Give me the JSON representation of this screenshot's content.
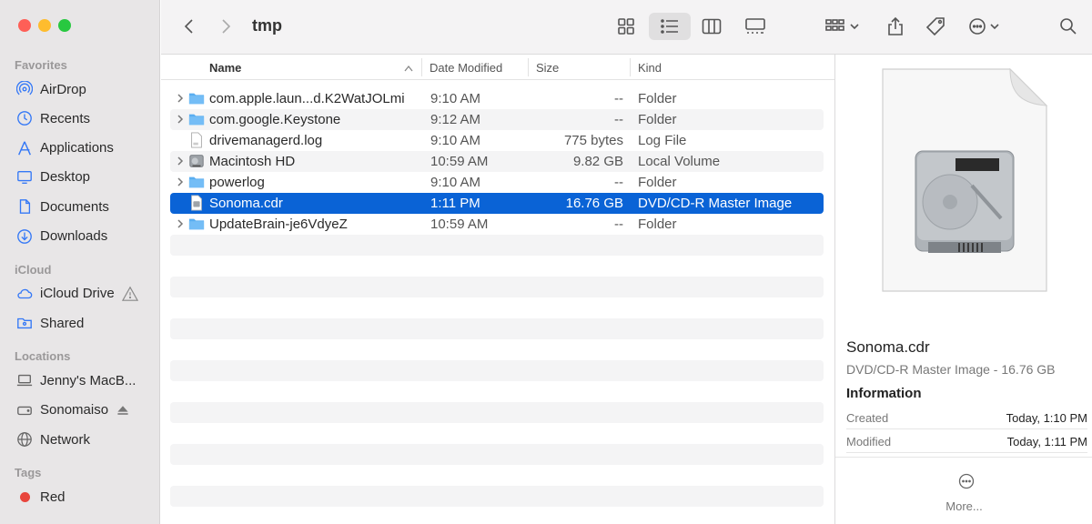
{
  "window": {
    "traffic_colors": [
      "#fe5f57",
      "#febc2e",
      "#28c840"
    ]
  },
  "sidebar": {
    "sections": [
      {
        "title": "Favorites",
        "items": [
          {
            "label": "AirDrop",
            "icon": "airdrop-icon"
          },
          {
            "label": "Recents",
            "icon": "clock-icon"
          },
          {
            "label": "Applications",
            "icon": "applications-icon"
          },
          {
            "label": "Desktop",
            "icon": "desktop-icon"
          },
          {
            "label": "Documents",
            "icon": "document-icon"
          },
          {
            "label": "Downloads",
            "icon": "download-icon"
          }
        ]
      },
      {
        "title": "iCloud",
        "items": [
          {
            "label": "iCloud Drive",
            "icon": "cloud-icon",
            "trail": "warning-icon"
          },
          {
            "label": "Shared",
            "icon": "shared-folder-icon"
          }
        ]
      },
      {
        "title": "Locations",
        "items": [
          {
            "label": "Jenny's MacB...",
            "icon": "laptop-icon"
          },
          {
            "label": "Sonomaiso",
            "icon": "disk-icon",
            "trail": "eject-icon"
          },
          {
            "label": "Network",
            "icon": "network-icon"
          }
        ]
      },
      {
        "title": "Tags",
        "items": [
          {
            "label": "Red",
            "icon": "red-tag-dot",
            "color": "#e8453c"
          }
        ]
      }
    ]
  },
  "toolbar": {
    "title": "tmp",
    "active_view": "list"
  },
  "list": {
    "columns": [
      "Name",
      "Date Modified",
      "Size",
      "Kind"
    ],
    "sort_column": "Name",
    "rows": [
      {
        "name": "com.apple.laun...d.K2WatJOLmi",
        "date": "9:10 AM",
        "size": "--",
        "kind": "Folder",
        "type": "folder",
        "expandable": true
      },
      {
        "name": "com.google.Keystone",
        "date": "9:12 AM",
        "size": "--",
        "kind": "Folder",
        "type": "folder",
        "expandable": true
      },
      {
        "name": "drivemanagerd.log",
        "date": "9:10 AM",
        "size": "775 bytes",
        "kind": "Log File",
        "type": "log",
        "expandable": false
      },
      {
        "name": "Macintosh HD",
        "date": "10:59 AM",
        "size": "9.82 GB",
        "kind": "Local Volume",
        "type": "volume",
        "expandable": true
      },
      {
        "name": "powerlog",
        "date": "9:10 AM",
        "size": "--",
        "kind": "Folder",
        "type": "folder",
        "expandable": true
      },
      {
        "name": "Sonoma.cdr",
        "date": "1:11 PM",
        "size": "16.76 GB",
        "kind": "DVD/CD-R Master Image",
        "type": "doc",
        "expandable": false,
        "selected": true
      },
      {
        "name": "UpdateBrain-je6VdyeZ",
        "date": "10:59 AM",
        "size": "--",
        "kind": "Folder",
        "type": "folder",
        "expandable": true
      }
    ],
    "selection_color": "#0a63d6"
  },
  "preview": {
    "name": "Sonoma.cdr",
    "subtitle": "DVD/CD-R Master Image - 16.76 GB",
    "info_title": "Information",
    "info": [
      {
        "key": "Created",
        "value": "Today, 1:10 PM"
      },
      {
        "key": "Modified",
        "value": "Today, 1:11 PM"
      }
    ],
    "more_label": "More..."
  }
}
